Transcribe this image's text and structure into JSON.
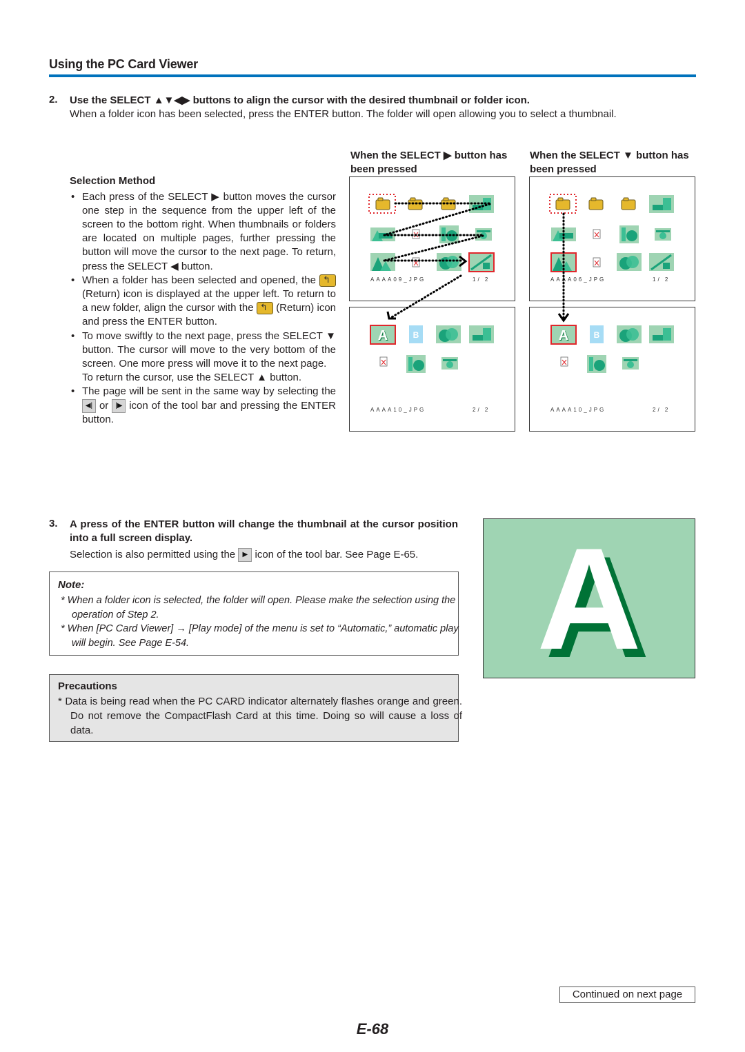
{
  "header": {
    "section_title": "Using the PC Card Viewer",
    "rule_color": "#0072bc"
  },
  "step2": {
    "number": "2.",
    "title": "Use the SELECT ▲▼◀▶ buttons to align the cursor with the desired thumbnail or folder icon.",
    "desc": "When a folder icon has been selected, press the ENTER button. The folder will open allowing you to select a thumbnail."
  },
  "selection_method": {
    "heading": "Selection Method",
    "bullet1": "Each press of the SELECT ▶ button moves the cursor one step in the sequence from the upper left of the screen to the bottom right. When thumbnails or folders are located on multiple pages, further pressing the button will move the cursor to the next page. To return, press the SELECT ◀ button.",
    "bullet2_a": "When a folder has been selected and opened, the",
    "bullet2_b": "(Return) icon is displayed at the upper left. To return to a new folder, align the cursor with the",
    "bullet2_c": "(Return) icon and press the ENTER button.",
    "bullet3": "To move swiftly to the next page, press the SELECT ▼ button. The cursor will move to the very bottom of the screen. One more press will move it to the next page.",
    "bullet3_extra": "To return the cursor, use the SELECT ▲ button.",
    "bullet4_a": "The page will be sent in the same way by selecting the",
    "bullet4_or": "or",
    "bullet4_b": "icon of the tool bar and pressing the ENTER button.",
    "icons": {
      "prev_page": "◀|",
      "next_page": "|▶"
    }
  },
  "figures": {
    "right_caption": "When the SELECT ▶ button has been pressed",
    "down_caption": "When the SELECT ▼ button has been pressed",
    "right_page1": {
      "filename": "AAAA09_JPG",
      "page": "1/ 2"
    },
    "right_page2": {
      "filename": "AAAA10_JPG",
      "page": "2/ 2"
    },
    "down_page1": {
      "filename": "AAAA06_JPG",
      "page": "1/ 2"
    },
    "down_page2": {
      "filename": "AAAA10_JPG",
      "page": "2/ 2"
    },
    "colors": {
      "thumb_bg": "#9fd4b3",
      "thumb_fg": "#1aa37a",
      "folder": "#e5b82c",
      "cursor": "#e0262b",
      "b_thumb": "#a6dcf5"
    }
  },
  "step3": {
    "number": "3.",
    "title": "A press of the ENTER button will change the thumbnail at the cursor position into a full screen display.",
    "desc_a": "Selection is also permitted using the",
    "desc_b": "icon of the tool bar. See Page E-65.",
    "play_icon": "▶"
  },
  "note": {
    "title": "Note:",
    "items": [
      "*  When a folder icon is selected, the folder will open. Please make the selection using the operation of Step 2.",
      "*  When [PC Card Viewer] → [Play mode] of the menu is set to “Automatic,” automatic play will begin. See Page E-54."
    ]
  },
  "precautions": {
    "title": "Precautions",
    "item": "*  Data is being read when the PC CARD indicator alternately flashes orange and green. Do not remove the CompactFlash Card at this time. Doing so will cause a loss of data."
  },
  "full_screen": {
    "letter": "A",
    "bg": "#9fd4b3",
    "shadow": "#007236"
  },
  "footer": {
    "continued": "Continued on next page",
    "page_number": "E-68"
  }
}
